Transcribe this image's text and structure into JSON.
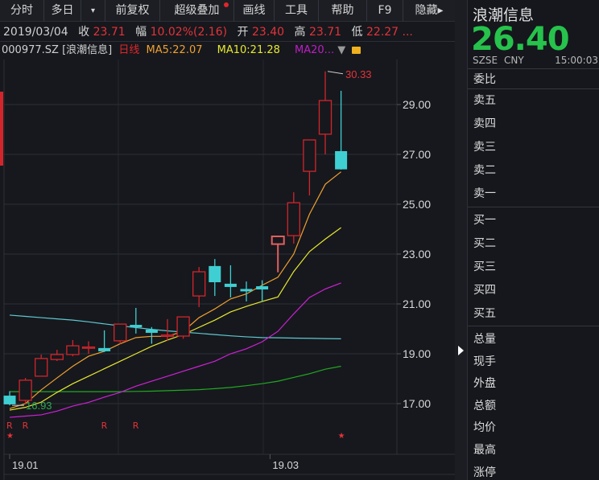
{
  "toolbar": {
    "items": [
      "分时",
      "多日",
      "▾",
      "前复权",
      "超级叠加",
      "画线",
      "工具",
      "帮助",
      "F9",
      "隐藏▸"
    ]
  },
  "info": {
    "date": "2019/03/04",
    "close_label": "收",
    "close": "23.71",
    "range_label": "幅",
    "range": "10.02%(2.16)",
    "open_label": "开",
    "open": "23.40",
    "high_label": "高",
    "high": "23.71",
    "low_label": "低",
    "low": "22.27 ..."
  },
  "legend": {
    "code": "000977.SZ",
    "name": "[浪潮信息]",
    "period": "日线",
    "ma5": "MA5:22.07",
    "ma10": "MA10:21.28",
    "ma20": "MA20...",
    "dropdown": "▼"
  },
  "panel": {
    "name": "浪潮信息",
    "price": "26.40",
    "exchange": "SZSE",
    "currency": "CNY",
    "time": "15:00:03",
    "ratio": "委比",
    "sell": [
      "卖五",
      "卖四",
      "卖三",
      "卖二",
      "卖一"
    ],
    "buy": [
      "买一",
      "买二",
      "买三",
      "买四",
      "买五"
    ],
    "stats": [
      "总量",
      "现手",
      "外盘",
      "总额",
      "均价",
      "最高",
      "涨停"
    ]
  },
  "colors": {
    "up": "#d2252b",
    "down": "#3fcfd2",
    "ma5": "#f0a030",
    "ma10": "#e8e830",
    "ma20": "#d020d8",
    "ma60": "#22a822",
    "ma_other": "#5fc8d0",
    "price": "#27c24c"
  },
  "chart_data": {
    "type": "candlestick",
    "ylim": [
      16.2,
      30.6
    ],
    "yticks": [
      "29.00",
      "27.00",
      "25.00",
      "23.00",
      "21.00",
      "19.00",
      "17.00"
    ],
    "xticks": [
      {
        "label": "19.01",
        "index": 0
      },
      {
        "label": "19.03",
        "index": 16.5
      }
    ],
    "high_marker": "30.33",
    "low_marker": "16.93",
    "candles": [
      [
        17.32,
        17.5,
        16.93,
        16.97
      ],
      [
        17.13,
        18.03,
        17.0,
        17.94
      ],
      [
        18.1,
        18.97,
        18.1,
        18.81
      ],
      [
        18.77,
        19.16,
        18.71,
        18.97
      ],
      [
        18.97,
        19.55,
        18.9,
        19.32
      ],
      [
        19.24,
        19.5,
        19.0,
        19.27
      ],
      [
        19.23,
        19.94,
        19.07,
        19.1
      ],
      [
        19.52,
        20.2,
        19.4,
        20.19
      ],
      [
        20.16,
        20.84,
        19.81,
        20.06
      ],
      [
        19.97,
        20.07,
        19.4,
        19.84
      ],
      [
        19.73,
        20.39,
        19.52,
        19.75
      ],
      [
        19.71,
        20.5,
        19.6,
        20.48
      ],
      [
        21.32,
        22.48,
        20.87,
        22.29
      ],
      [
        22.52,
        22.8,
        21.32,
        21.87
      ],
      [
        21.81,
        22.55,
        21.26,
        21.68
      ],
      [
        21.6,
        21.9,
        21.1,
        21.56
      ],
      [
        21.71,
        21.95,
        21.1,
        21.58
      ],
      [
        23.4,
        23.71,
        22.27,
        23.71
      ],
      [
        23.74,
        25.48,
        23.42,
        25.06
      ],
      [
        26.32,
        27.58,
        25.35,
        27.58
      ],
      [
        27.81,
        30.33,
        27.0,
        29.16
      ],
      [
        27.13,
        29.55,
        26.39,
        26.4
      ]
    ],
    "series": [
      {
        "name": "MA5",
        "color": "ma5",
        "values": [
          16.8,
          17.0,
          17.55,
          18.03,
          18.5,
          18.9,
          19.1,
          19.4,
          19.65,
          19.7,
          19.7,
          19.9,
          20.45,
          20.8,
          21.2,
          21.4,
          21.75,
          22.07,
          23.0,
          24.6,
          25.8,
          26.3
        ]
      },
      {
        "name": "MA10",
        "color": "ma10",
        "values": [
          16.74,
          16.85,
          17.06,
          17.45,
          17.8,
          18.1,
          18.4,
          18.7,
          19.0,
          19.3,
          19.55,
          19.77,
          20.06,
          20.35,
          20.68,
          20.9,
          21.1,
          21.28,
          22.3,
          23.1,
          23.6,
          24.06
        ]
      },
      {
        "name": "MA20",
        "color": "ma20",
        "values": [
          16.45,
          16.5,
          16.55,
          16.7,
          16.9,
          17.05,
          17.26,
          17.45,
          17.7,
          17.9,
          18.1,
          18.3,
          18.5,
          18.7,
          19.0,
          19.2,
          19.48,
          19.9,
          20.6,
          21.26,
          21.6,
          21.84
        ]
      },
      {
        "name": "MA60",
        "color": "ma60",
        "values": [
          17.48,
          17.48,
          17.48,
          17.48,
          17.48,
          17.48,
          17.48,
          17.48,
          17.49,
          17.5,
          17.52,
          17.54,
          17.56,
          17.6,
          17.65,
          17.72,
          17.8,
          17.9,
          18.05,
          18.2,
          18.38,
          18.5
        ]
      },
      {
        "name": "MA",
        "color": "ma_other",
        "values": [
          20.55,
          20.5,
          20.45,
          20.4,
          20.35,
          20.28,
          20.2,
          20.12,
          20.05,
          19.98,
          19.92,
          19.87,
          19.82,
          19.77,
          19.72,
          19.68,
          19.65,
          19.64,
          19.63,
          19.62,
          19.61,
          19.6
        ]
      }
    ],
    "markers": [
      {
        "index": 0,
        "text": "R"
      },
      {
        "index": 1,
        "text": "R"
      },
      {
        "index": 6,
        "text": "R"
      },
      {
        "index": 8,
        "text": "R"
      },
      {
        "index": 0,
        "text": "★"
      },
      {
        "index": 21,
        "text": "★"
      }
    ]
  }
}
